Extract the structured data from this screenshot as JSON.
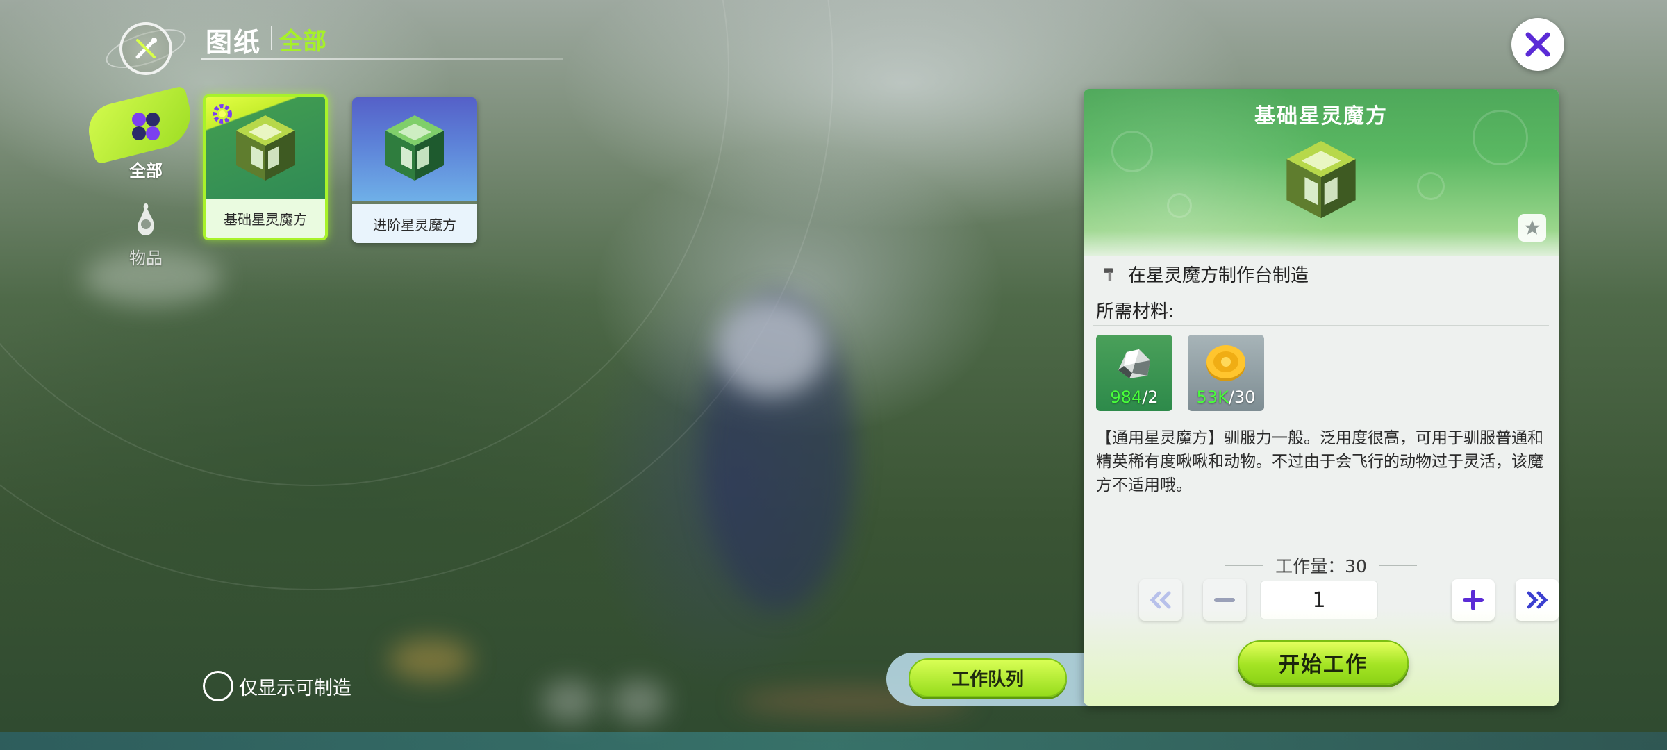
{
  "header": {
    "title": "图纸",
    "subtitle": "全部"
  },
  "categories": [
    {
      "label": "全部",
      "icon": "clover-icon",
      "selected": true
    },
    {
      "label": "物品",
      "icon": "potion-icon",
      "selected": false
    }
  ],
  "blueprints": [
    {
      "name": "基础星灵魔方",
      "selected": true,
      "badge": "gear-icon"
    },
    {
      "name": "进阶星灵魔方",
      "selected": false
    }
  ],
  "filter": {
    "only_craftable_label": "仅显示可制造",
    "checked": false
  },
  "queue": {
    "label": "工作队列"
  },
  "detail": {
    "title": "基础星灵魔方",
    "station": "在星灵魔方制作台制造",
    "materials_label": "所需材料:",
    "materials": [
      {
        "icon": "ore-icon",
        "have": "984",
        "need": "/2"
      },
      {
        "icon": "gold-coin-icon",
        "have": "53K",
        "need": "/30"
      }
    ],
    "description": "【通用星灵魔方】驯服力一般。泛用度很高，可用于驯服普通和精英稀有度啾啾和动物。不过由于会飞行的动物过于灵活，该魔方不适用哦。",
    "workload": "工作量：30",
    "quantity": "1",
    "start_label": "开始工作"
  },
  "colors": {
    "accent": "#a6f02a",
    "panel_header": "#5ab862",
    "close_icon": "#5b2bd6"
  }
}
